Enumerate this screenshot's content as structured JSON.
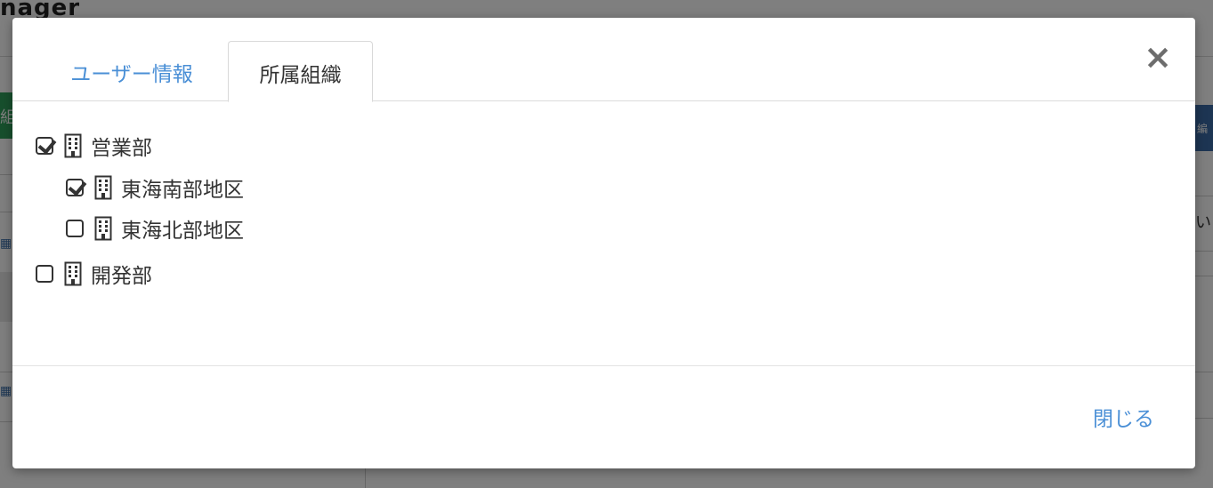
{
  "background": {
    "brand_text": "nager",
    "green_tab_text": "組",
    "blue_button_text": "編",
    "right_text": "い"
  },
  "modal": {
    "tabs": [
      {
        "label": "ユーザー情報",
        "active": false
      },
      {
        "label": "所属組織",
        "active": true
      }
    ],
    "close_icon": "×",
    "tree": [
      {
        "label": "営業部",
        "checked": true,
        "level": 0
      },
      {
        "label": "東海南部地区",
        "checked": true,
        "level": 1
      },
      {
        "label": "東海北部地区",
        "checked": false,
        "level": 1
      },
      {
        "label": "開発部",
        "checked": false,
        "level": 0
      }
    ],
    "footer": {
      "close_label": "閉じる"
    }
  },
  "colors": {
    "link": "#4a8fd6",
    "text": "#333333",
    "overlay": "rgba(0,0,0,0.5)"
  }
}
